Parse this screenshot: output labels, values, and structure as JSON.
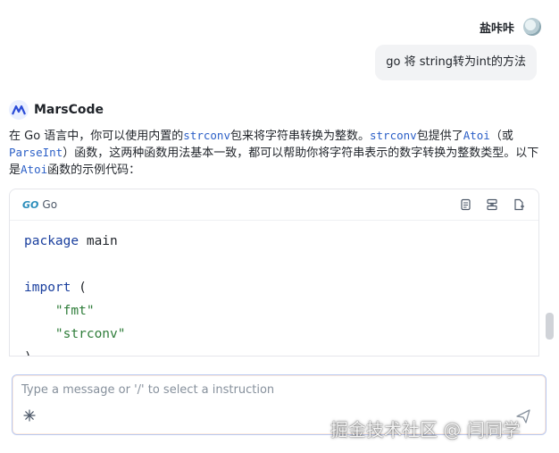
{
  "user": {
    "name": "盐咔咔",
    "message": "go 将 string转为int的方法"
  },
  "bot": {
    "name": "MarsCode",
    "intro": [
      {
        "t": "text",
        "v": "在 Go 语言中，你可以使用内置的"
      },
      {
        "t": "code",
        "v": "strconv"
      },
      {
        "t": "text",
        "v": "包来将字符串转换为整数。"
      },
      {
        "t": "code",
        "v": "strconv"
      },
      {
        "t": "text",
        "v": "包提供了"
      },
      {
        "t": "code",
        "v": "Atoi"
      },
      {
        "t": "text",
        "v": "（或"
      },
      {
        "t": "code",
        "v": "ParseInt"
      },
      {
        "t": "text",
        "v": "）函数，这两种函数用法基本一致，都可以帮助你将字符串表示的数字转换为整数类型。以下是"
      },
      {
        "t": "code",
        "v": "Atoi"
      },
      {
        "t": "text",
        "v": "函数的示例代码："
      }
    ]
  },
  "code_block": {
    "lang_logo": "GO",
    "lang": "Go",
    "lines": [
      [
        {
          "c": "kw",
          "v": "package"
        },
        {
          "c": "id",
          "v": " main"
        }
      ],
      [],
      [
        {
          "c": "kw",
          "v": "import"
        },
        {
          "c": "id",
          "v": " ("
        }
      ],
      [
        {
          "c": "id",
          "v": "    "
        },
        {
          "c": "str",
          "v": "\"fmt\""
        }
      ],
      [
        {
          "c": "id",
          "v": "    "
        },
        {
          "c": "str",
          "v": "\"strconv\""
        }
      ],
      [
        {
          "c": "id",
          "v": ")"
        }
      ]
    ],
    "tools": [
      "copy-icon",
      "insert-icon",
      "apply-icon"
    ]
  },
  "input": {
    "placeholder": "Type a message or '/' to select a instruction"
  },
  "watermark": "掘金技术社区 @ 闫同学"
}
